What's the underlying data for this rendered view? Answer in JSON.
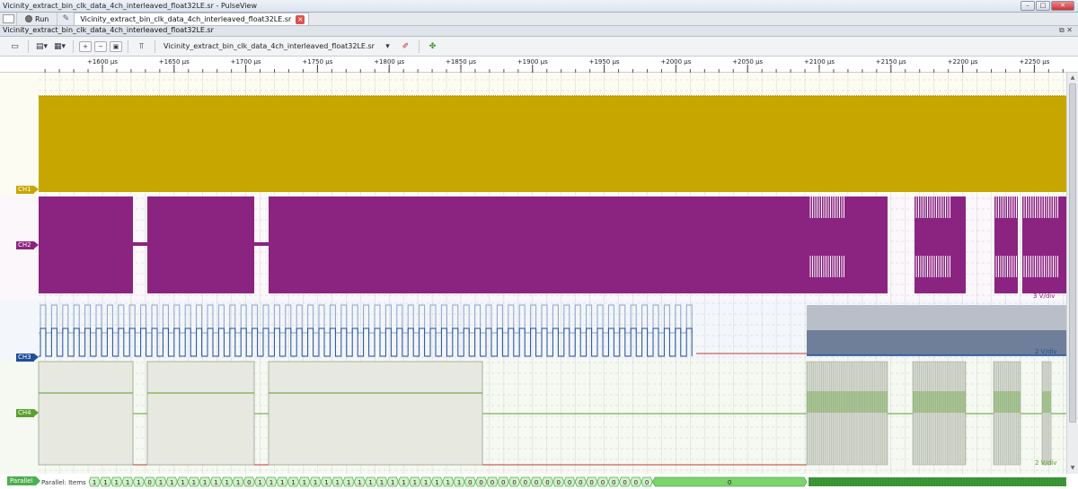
{
  "window": {
    "title": "Vicinity_extract_bin_clk_data_4ch_interleaved_float32LE.sr - PulseView",
    "buttons": {
      "minimize": "–",
      "maximize": "□",
      "close": "✕"
    }
  },
  "tabbar": {
    "run_label": "Run",
    "tab_label": "Vicinity_extract_bin_clk_data_4ch_interleaved_float32LE.sr"
  },
  "session": {
    "title": "Vicinity_extract_bin_clk_data_4ch_interleaved_float32LE.sr",
    "dock_icon": "⧉ ✕"
  },
  "toolbar": {
    "device_label": "Vicinity_extract_bin_clk_data_4ch_interleaved_float32LE.sr"
  },
  "ruler": {
    "ticks": [
      "+1600 µs",
      "+1650 µs",
      "+1700 µs",
      "+1750 µs",
      "+1800 µs",
      "+1850 µs",
      "+1900 µs",
      "+1950 µs",
      "+2000 µs",
      "+2050 µs",
      "+2100 µs",
      "+2150 µs",
      "+2200 µs",
      "+2250 µs"
    ]
  },
  "channels": [
    {
      "name": "CH1",
      "color": "#c8a600"
    },
    {
      "name": "CH2",
      "color": "#8b2381"
    },
    {
      "name": "CH3",
      "color": "#1f4e9a"
    },
    {
      "name": "CH4",
      "color": "#5aa02c"
    }
  ],
  "vdiv": {
    "ch2": "3 V/div",
    "ch3": "2 V/div",
    "ch4": "2 V/div"
  },
  "decoder": {
    "name": "Parallel",
    "row_label": "Parallel: Items",
    "values": [
      "1",
      "1",
      "1",
      "1",
      "1",
      "0",
      "1",
      "1",
      "1",
      "1",
      "1",
      "1",
      "1",
      "1",
      "0",
      "1",
      "1",
      "1",
      "1",
      "1",
      "1",
      "1",
      "1",
      "1",
      "1",
      "1",
      "1",
      "1",
      "1",
      "1",
      "1",
      "1",
      "1",
      "1",
      "0",
      "0",
      "0",
      "0",
      "0",
      "0",
      "0",
      "0",
      "0",
      "0",
      "0",
      "0",
      "0",
      "0",
      "0",
      "0",
      "0"
    ],
    "wide_value": "0",
    "color": "#4caf50"
  }
}
